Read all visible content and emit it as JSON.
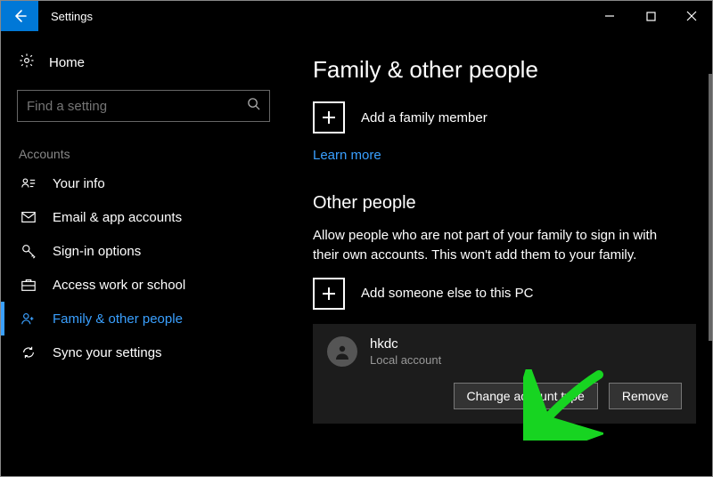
{
  "window": {
    "title": "Settings"
  },
  "left": {
    "home": "Home",
    "search_placeholder": "Find a setting",
    "section": "Accounts",
    "nav": [
      {
        "label": "Your info"
      },
      {
        "label": "Email & app accounts"
      },
      {
        "label": "Sign-in options"
      },
      {
        "label": "Access work or school"
      },
      {
        "label": "Family & other people"
      },
      {
        "label": "Sync your settings"
      }
    ]
  },
  "main": {
    "heading": "Family & other people",
    "add_family_label": "Add a family member",
    "learn_more": "Learn more",
    "other_heading": "Other people",
    "other_desc": "Allow people who are not part of your family to sign in with their own accounts. This won't add them to your family.",
    "add_other_label": "Add someone else to this PC",
    "person": {
      "name": "hkdc",
      "type": "Local account"
    },
    "change_btn": "Change account type",
    "remove_btn": "Remove"
  }
}
